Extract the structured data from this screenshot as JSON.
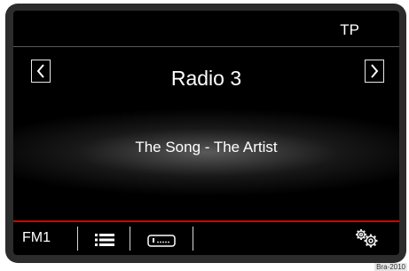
{
  "status": {
    "tp": "TP"
  },
  "radio": {
    "station": "Radio 3",
    "now_playing": "The Song - The Artist"
  },
  "bottom": {
    "band": "FM1"
  },
  "footer": {
    "image_code": "Bra-2010"
  },
  "icons": {
    "prev": "chevron-left-icon",
    "next": "chevron-right-icon",
    "list": "list-icon",
    "radiotext": "radiotext-icon",
    "settings": "gears-icon"
  },
  "colors": {
    "accent": "#d80000",
    "background": "#000000",
    "text": "#ffffff"
  }
}
